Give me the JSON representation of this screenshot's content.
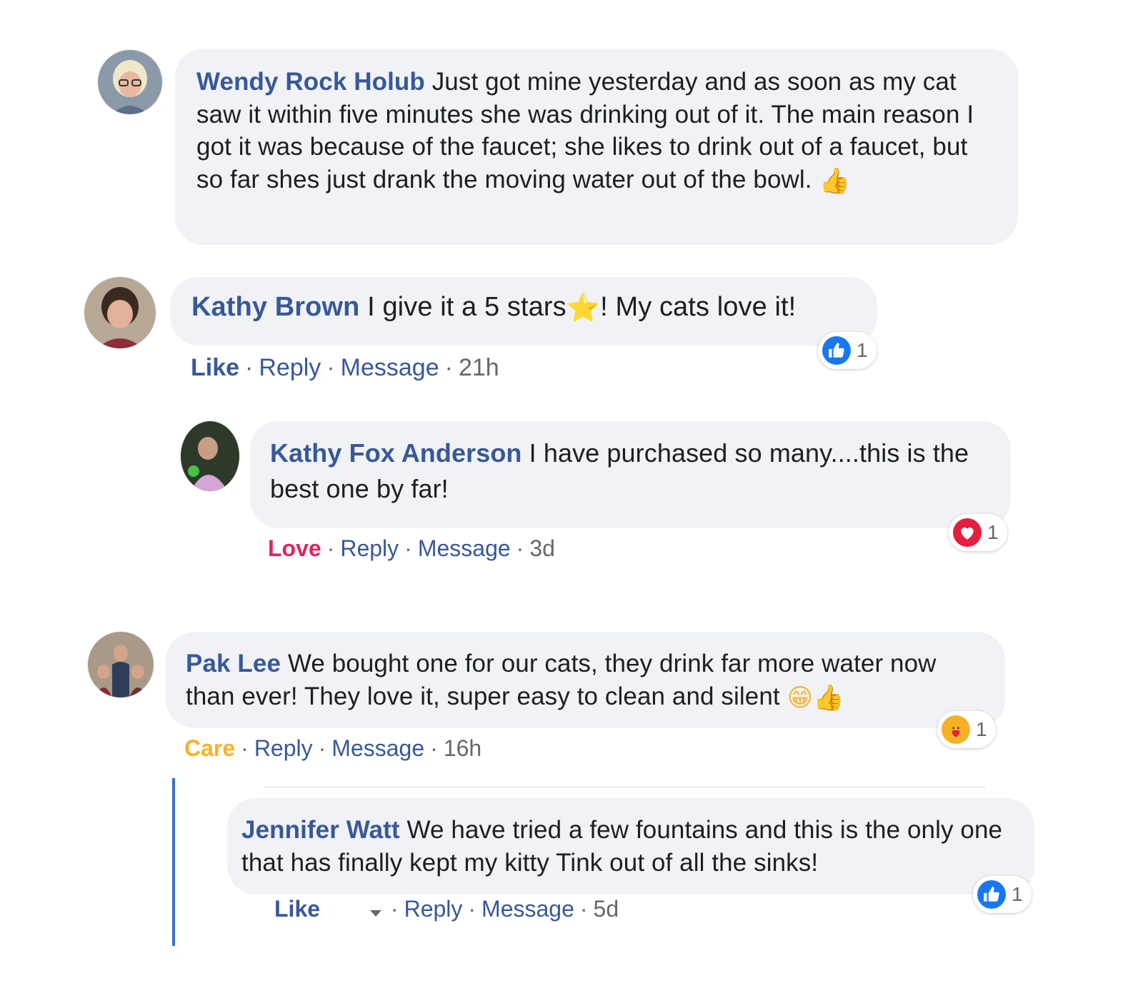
{
  "colors": {
    "accent": "#385898",
    "bubble_bg": "#f0f2f5",
    "like_blue": "#1877f2",
    "love_red": "#e0245e",
    "care_yellow": "#f7b125"
  },
  "comments": [
    {
      "author": "Wendy Rock Holub",
      "text": "Just got mine yesterday and as soon as my cat saw it within five minutes she was drinking out of it. The main reason I got it was because of the faucet; she likes to drink out of a faucet, but so far shes just drank the moving water out of the bowl.",
      "emoji": "👍",
      "emoji_icon": "thumbs-up-icon"
    },
    {
      "author": "Kathy Brown",
      "text_before": "I give it a 5 stars",
      "emoji": "⭐",
      "emoji_icon": "star-icon",
      "text_after": "! My cats love it!",
      "reaction_action": "Like",
      "reply": "Reply",
      "message": "Message",
      "time": "21h",
      "reaction_count": "1",
      "reaction_icon": "like-icon"
    },
    {
      "author": "Kathy Fox Anderson",
      "text": "I have purchased so many....this is the best one by far!",
      "reaction_action": "Love",
      "reply": "Reply",
      "message": "Message",
      "time": "3d",
      "reaction_count": "1",
      "reaction_icon": "love-icon"
    },
    {
      "author": "Pak Lee",
      "text": "We bought one for our cats, they drink far more water now than ever! They love it, super easy to clean and silent",
      "emoji": "😁👍",
      "emoji_icons": [
        "grinning-face-icon",
        "thumbs-up-icon"
      ],
      "reaction_action": "Care",
      "reply": "Reply",
      "message": "Message",
      "time": "16h",
      "reaction_count": "1",
      "reaction_icon": "care-icon"
    },
    {
      "author": "Jennifer Watt",
      "text": "We have tried a few fountains and this is the only one that has finally kept my kitty Tink out of all the sinks!",
      "reaction_action": "Like",
      "reply": "Reply",
      "message": "Message",
      "time": "5d",
      "reaction_count": "1",
      "reaction_icon": "like-icon"
    }
  ]
}
